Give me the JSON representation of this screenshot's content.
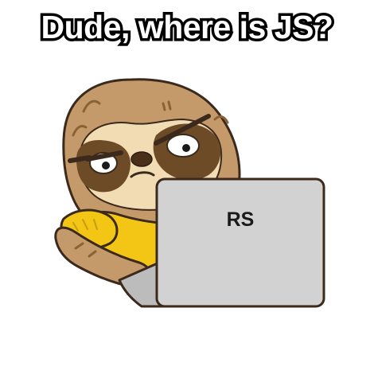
{
  "meme": {
    "caption": "Dude, where is JS?",
    "laptop_label": "RS"
  },
  "colors": {
    "fur_light": "#c59a6a",
    "fur_dark": "#8a6236",
    "face_cream": "#f2dcb3",
    "eye_patch": "#6e4b27",
    "shirt_yellow": "#f3c615",
    "laptop_gray": "#d2d2d2",
    "outline": "#3b2a1c"
  },
  "icons": {
    "character": "sloth-with-laptop",
    "device": "laptop"
  }
}
